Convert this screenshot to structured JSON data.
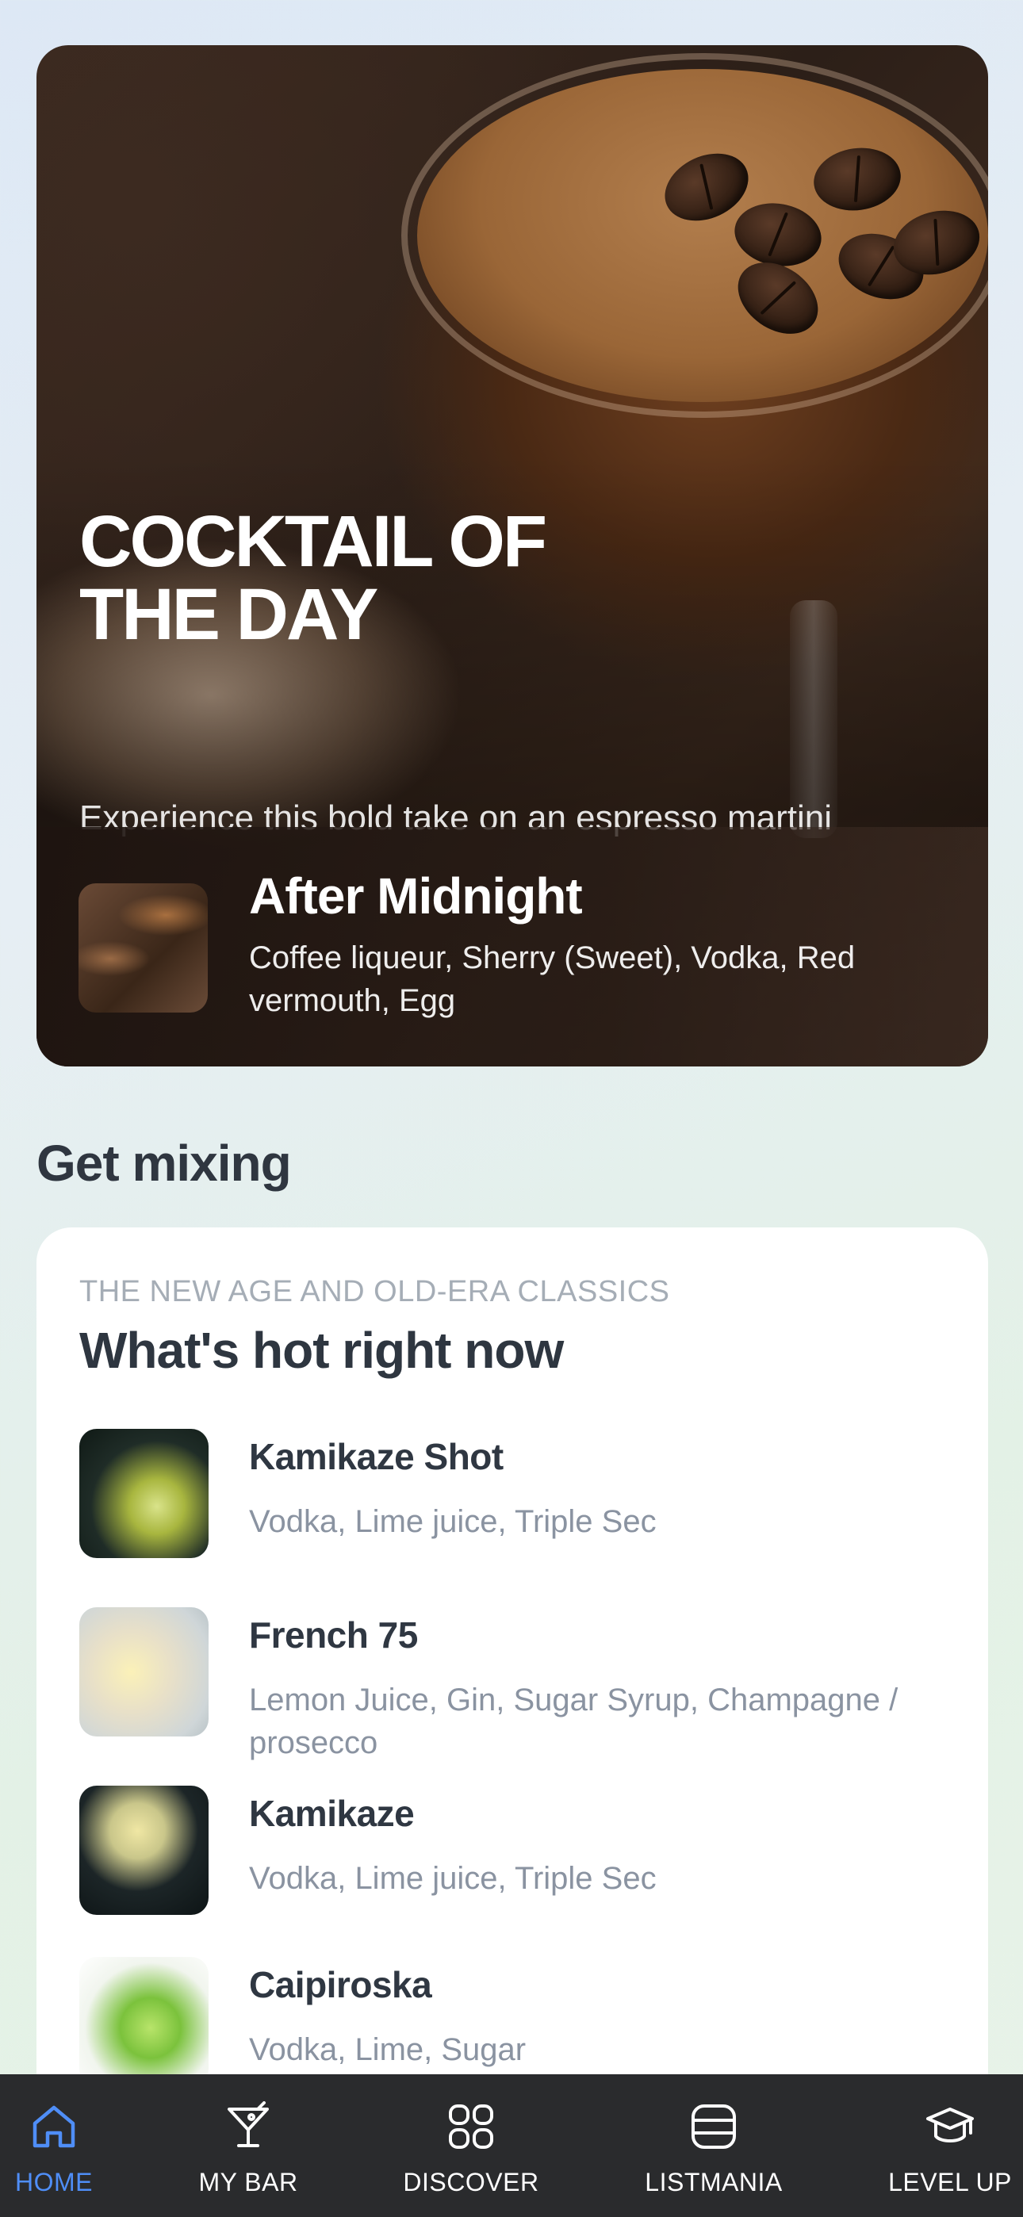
{
  "hero": {
    "title": "COCKTAIL OF THE DAY",
    "subtitle": "Experience this bold take on an espresso martini",
    "featured": {
      "name": "After Midnight",
      "ingredients": "Coffee liqueur, Sherry (Sweet), Vodka, Red vermouth, Egg"
    }
  },
  "section": {
    "title": "Get mixing"
  },
  "card": {
    "eyebrow": "THE NEW AGE AND OLD-ERA CLASSICS",
    "title": "What's hot right now",
    "drinks": [
      {
        "name": "Kamikaze Shot",
        "ingredients": "Vodka, Lime juice, Triple Sec"
      },
      {
        "name": "French 75",
        "ingredients": "Lemon Juice, Gin, Sugar Syrup, Champagne / prosecco"
      },
      {
        "name": "Kamikaze",
        "ingredients": "Vodka, Lime juice, Triple Sec"
      },
      {
        "name": "Caipiroska",
        "ingredients": "Vodka, Lime, Sugar"
      }
    ]
  },
  "tabbar": {
    "active_color": "#4f8ef7",
    "tabs": [
      {
        "label": "HOME",
        "icon": "home-icon",
        "active": true
      },
      {
        "label": "MY BAR",
        "icon": "cocktail-glass-icon",
        "active": false
      },
      {
        "label": "DISCOVER",
        "icon": "grid-icon",
        "active": false
      },
      {
        "label": "LISTMANIA",
        "icon": "list-icon",
        "active": false
      },
      {
        "label": "LEVEL UP",
        "icon": "graduation-cap-icon",
        "active": false
      }
    ]
  }
}
